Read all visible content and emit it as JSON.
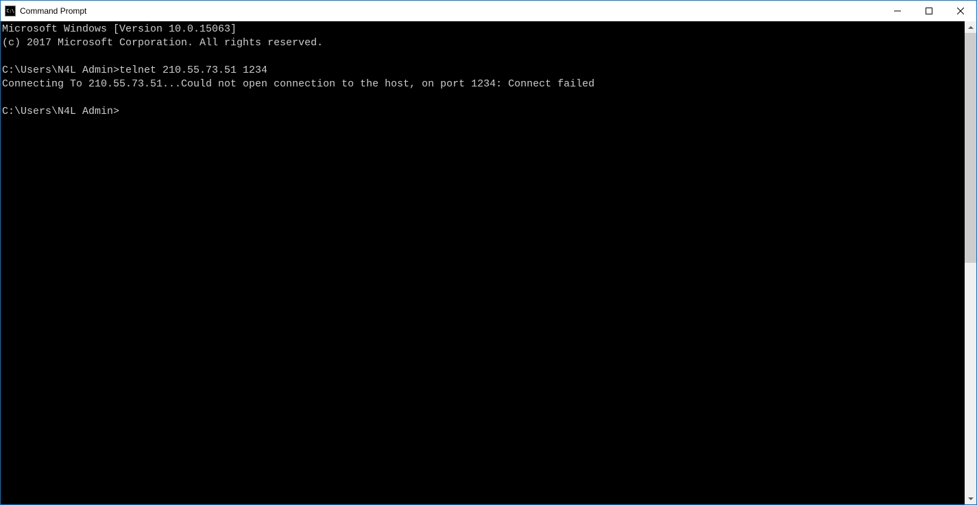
{
  "window": {
    "title": "Command Prompt"
  },
  "terminal": {
    "lines": [
      "Microsoft Windows [Version 10.0.15063]",
      "(c) 2017 Microsoft Corporation. All rights reserved.",
      "",
      "C:\\Users\\N4L Admin>telnet 210.55.73.51 1234",
      "Connecting To 210.55.73.51...Could not open connection to the host, on port 1234: Connect failed",
      "",
      "C:\\Users\\N4L Admin>"
    ]
  }
}
